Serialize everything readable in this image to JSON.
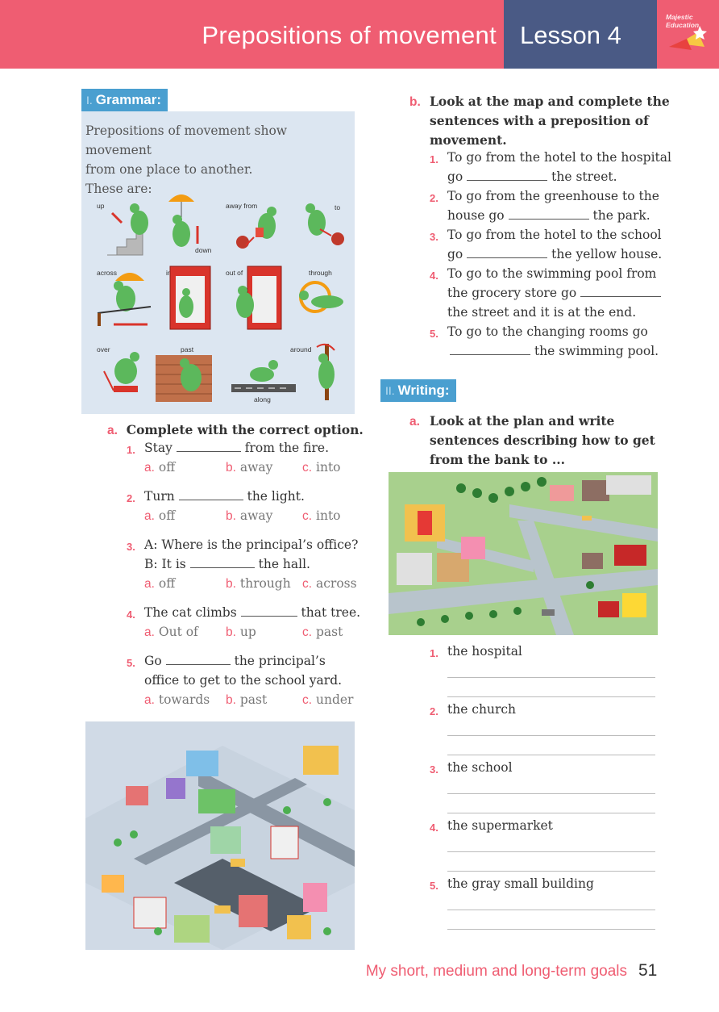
{
  "header": {
    "title": "Prepositions of movement",
    "lesson": "Lesson 4",
    "logo_text": "Majestic Education"
  },
  "grammar": {
    "num": "I.",
    "heading": "Grammar:",
    "line1": "Prepositions of movement show movement",
    "line2": "from one place to another.",
    "line3": "These are:",
    "labels": [
      "up",
      "down",
      "away from",
      "to",
      "across",
      "into",
      "out of",
      "through",
      "over",
      "past",
      "along",
      "around"
    ]
  },
  "exercise_a": {
    "letter": "a.",
    "instruction": "Complete with the correct option.",
    "questions": [
      {
        "num": "1.",
        "pre": "Stay",
        "post": "from the fire.",
        "opts": [
          [
            "a.",
            "off"
          ],
          [
            "b.",
            "away"
          ],
          [
            "c.",
            "into"
          ]
        ]
      },
      {
        "num": "2.",
        "pre": "Turn",
        "post": "the light.",
        "opts": [
          [
            "a.",
            "off"
          ],
          [
            "b.",
            "away"
          ],
          [
            "c.",
            "into"
          ]
        ]
      },
      {
        "num": "3.",
        "line1": "A: Where is the principal’s office?",
        "pre": "B: It is",
        "post": "the hall.",
        "opts": [
          [
            "a.",
            "off"
          ],
          [
            "b.",
            "through"
          ],
          [
            "c.",
            "across"
          ]
        ]
      },
      {
        "num": "4.",
        "pre": "The cat climbs",
        "post": "that tree.",
        "opts": [
          [
            "a.",
            "Out of"
          ],
          [
            "b.",
            "up"
          ],
          [
            "c.",
            "past"
          ]
        ]
      },
      {
        "num": "5.",
        "pre": "Go",
        "post": "the principal’s",
        "line2": "office to get to the school yard.",
        "opts": [
          [
            "a.",
            "towards"
          ],
          [
            "b.",
            "past"
          ],
          [
            "c.",
            "under"
          ]
        ]
      }
    ]
  },
  "exercise_b": {
    "letter": "b.",
    "instruction": [
      "Look at the map and complete the",
      "sentences with a preposition of",
      "movement."
    ],
    "items": [
      {
        "num": "1.",
        "l1": "To go from the hotel to the hospital",
        "pre2": "go",
        "post2": "the street."
      },
      {
        "num": "2.",
        "l1": "To go from the greenhouse to the",
        "pre2": "house go",
        "post2": "the park."
      },
      {
        "num": "3.",
        "l1": "To go from the hotel to the school",
        "pre2": "go",
        "post2": "the yellow house."
      },
      {
        "num": "4.",
        "l1": "To go to the swimming pool from",
        "pre2": "the grocery store go",
        "post2": "",
        "l3": "the street and it is at the end."
      },
      {
        "num": "5.",
        "l1": "To go to the changing rooms go",
        "pre2": "",
        "post2": "the swimming pool."
      }
    ]
  },
  "writing": {
    "num": "II.",
    "heading": "Writing:",
    "letter": "a.",
    "instruction": [
      "Look at the plan and write",
      "sentences describing how to get",
      "from the bank to ..."
    ],
    "items": [
      {
        "num": "1.",
        "text": "the hospital"
      },
      {
        "num": "2.",
        "text": "the church"
      },
      {
        "num": "3.",
        "text": "the school"
      },
      {
        "num": "4.",
        "text": "the supermarket"
      },
      {
        "num": "5.",
        "text": "the gray small building"
      }
    ]
  },
  "footer": {
    "goals": "My short, medium and long-term goals",
    "page": "51"
  },
  "colors": {
    "pink": "#ef5d72",
    "navy": "#4a5a85",
    "blue": "#4a9fd0",
    "panel": "#dce6f1"
  }
}
